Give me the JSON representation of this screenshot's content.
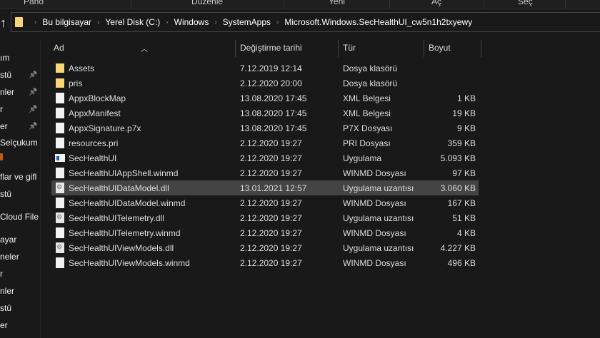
{
  "ribbon": [
    "Pano",
    "Düzenle",
    "Yeni",
    "Aç",
    "Seç"
  ],
  "breadcrumb": [
    "Bu bilgisayar",
    "Yerel Disk (C:)",
    "Windows",
    "SystemApps",
    "Microsoft.Windows.SecHealthUI_cw5n1h2txyewy"
  ],
  "sidebar": [
    "ım",
    "stü",
    "nler",
    "r",
    "er",
    "Selçukum",
    "flar ve gifl",
    "stü",
    "Cloud File",
    "ayar",
    "neler",
    "r",
    "nler",
    "stü",
    "er"
  ],
  "columns": [
    "Ad",
    "Değiştirme tarihi",
    "Tür",
    "Boyut"
  ],
  "files": [
    {
      "name": "Assets",
      "date": "7.12.2019 12:14",
      "type": "Dosya klasörü",
      "size": "",
      "icon": "folder"
    },
    {
      "name": "pris",
      "date": "2.12.2020 20:00",
      "type": "Dosya klasörü",
      "size": "",
      "icon": "folder"
    },
    {
      "name": "AppxBlockMap",
      "date": "13.08.2020 17:45",
      "type": "XML Belgesi",
      "size": "1 KB",
      "icon": "file"
    },
    {
      "name": "AppxManifest",
      "date": "13.08.2020 17:45",
      "type": "XML Belgesi",
      "size": "19 KB",
      "icon": "file"
    },
    {
      "name": "AppxSignature.p7x",
      "date": "13.08.2020 17:45",
      "type": "P7X Dosyası",
      "size": "9 KB",
      "icon": "file"
    },
    {
      "name": "resources.pri",
      "date": "2.12.2020 19:27",
      "type": "PRI Dosyası",
      "size": "359 KB",
      "icon": "file"
    },
    {
      "name": "SecHealthUI",
      "date": "2.12.2020 19:27",
      "type": "Uygulama",
      "size": "5.093 KB",
      "icon": "app"
    },
    {
      "name": "SecHealthUIAppShell.winmd",
      "date": "2.12.2020 19:27",
      "type": "WINMD Dosyası",
      "size": "97 KB",
      "icon": "file"
    },
    {
      "name": "SecHealthUIDataModel.dll",
      "date": "13.01.2021 12:57",
      "type": "Uygulama uzantısı",
      "size": "3.060 KB",
      "icon": "dll",
      "selected": true
    },
    {
      "name": "SecHealthUIDataModel.winmd",
      "date": "2.12.2020 19:27",
      "type": "WINMD Dosyası",
      "size": "167 KB",
      "icon": "file"
    },
    {
      "name": "SecHealthUITelemetry.dll",
      "date": "2.12.2020 19:27",
      "type": "Uygulama uzantısı",
      "size": "51 KB",
      "icon": "dll"
    },
    {
      "name": "SecHealthUITelemetry.winmd",
      "date": "2.12.2020 19:27",
      "type": "WINMD Dosyası",
      "size": "4 KB",
      "icon": "file"
    },
    {
      "name": "SecHealthUIViewModels.dll",
      "date": "2.12.2020 19:27",
      "type": "Uygulama uzantısı",
      "size": "4.227 KB",
      "icon": "dll"
    },
    {
      "name": "SecHealthUIViewModels.winmd",
      "date": "2.12.2020 19:27",
      "type": "WINMD Dosyası",
      "size": "496 KB",
      "icon": "file"
    }
  ]
}
